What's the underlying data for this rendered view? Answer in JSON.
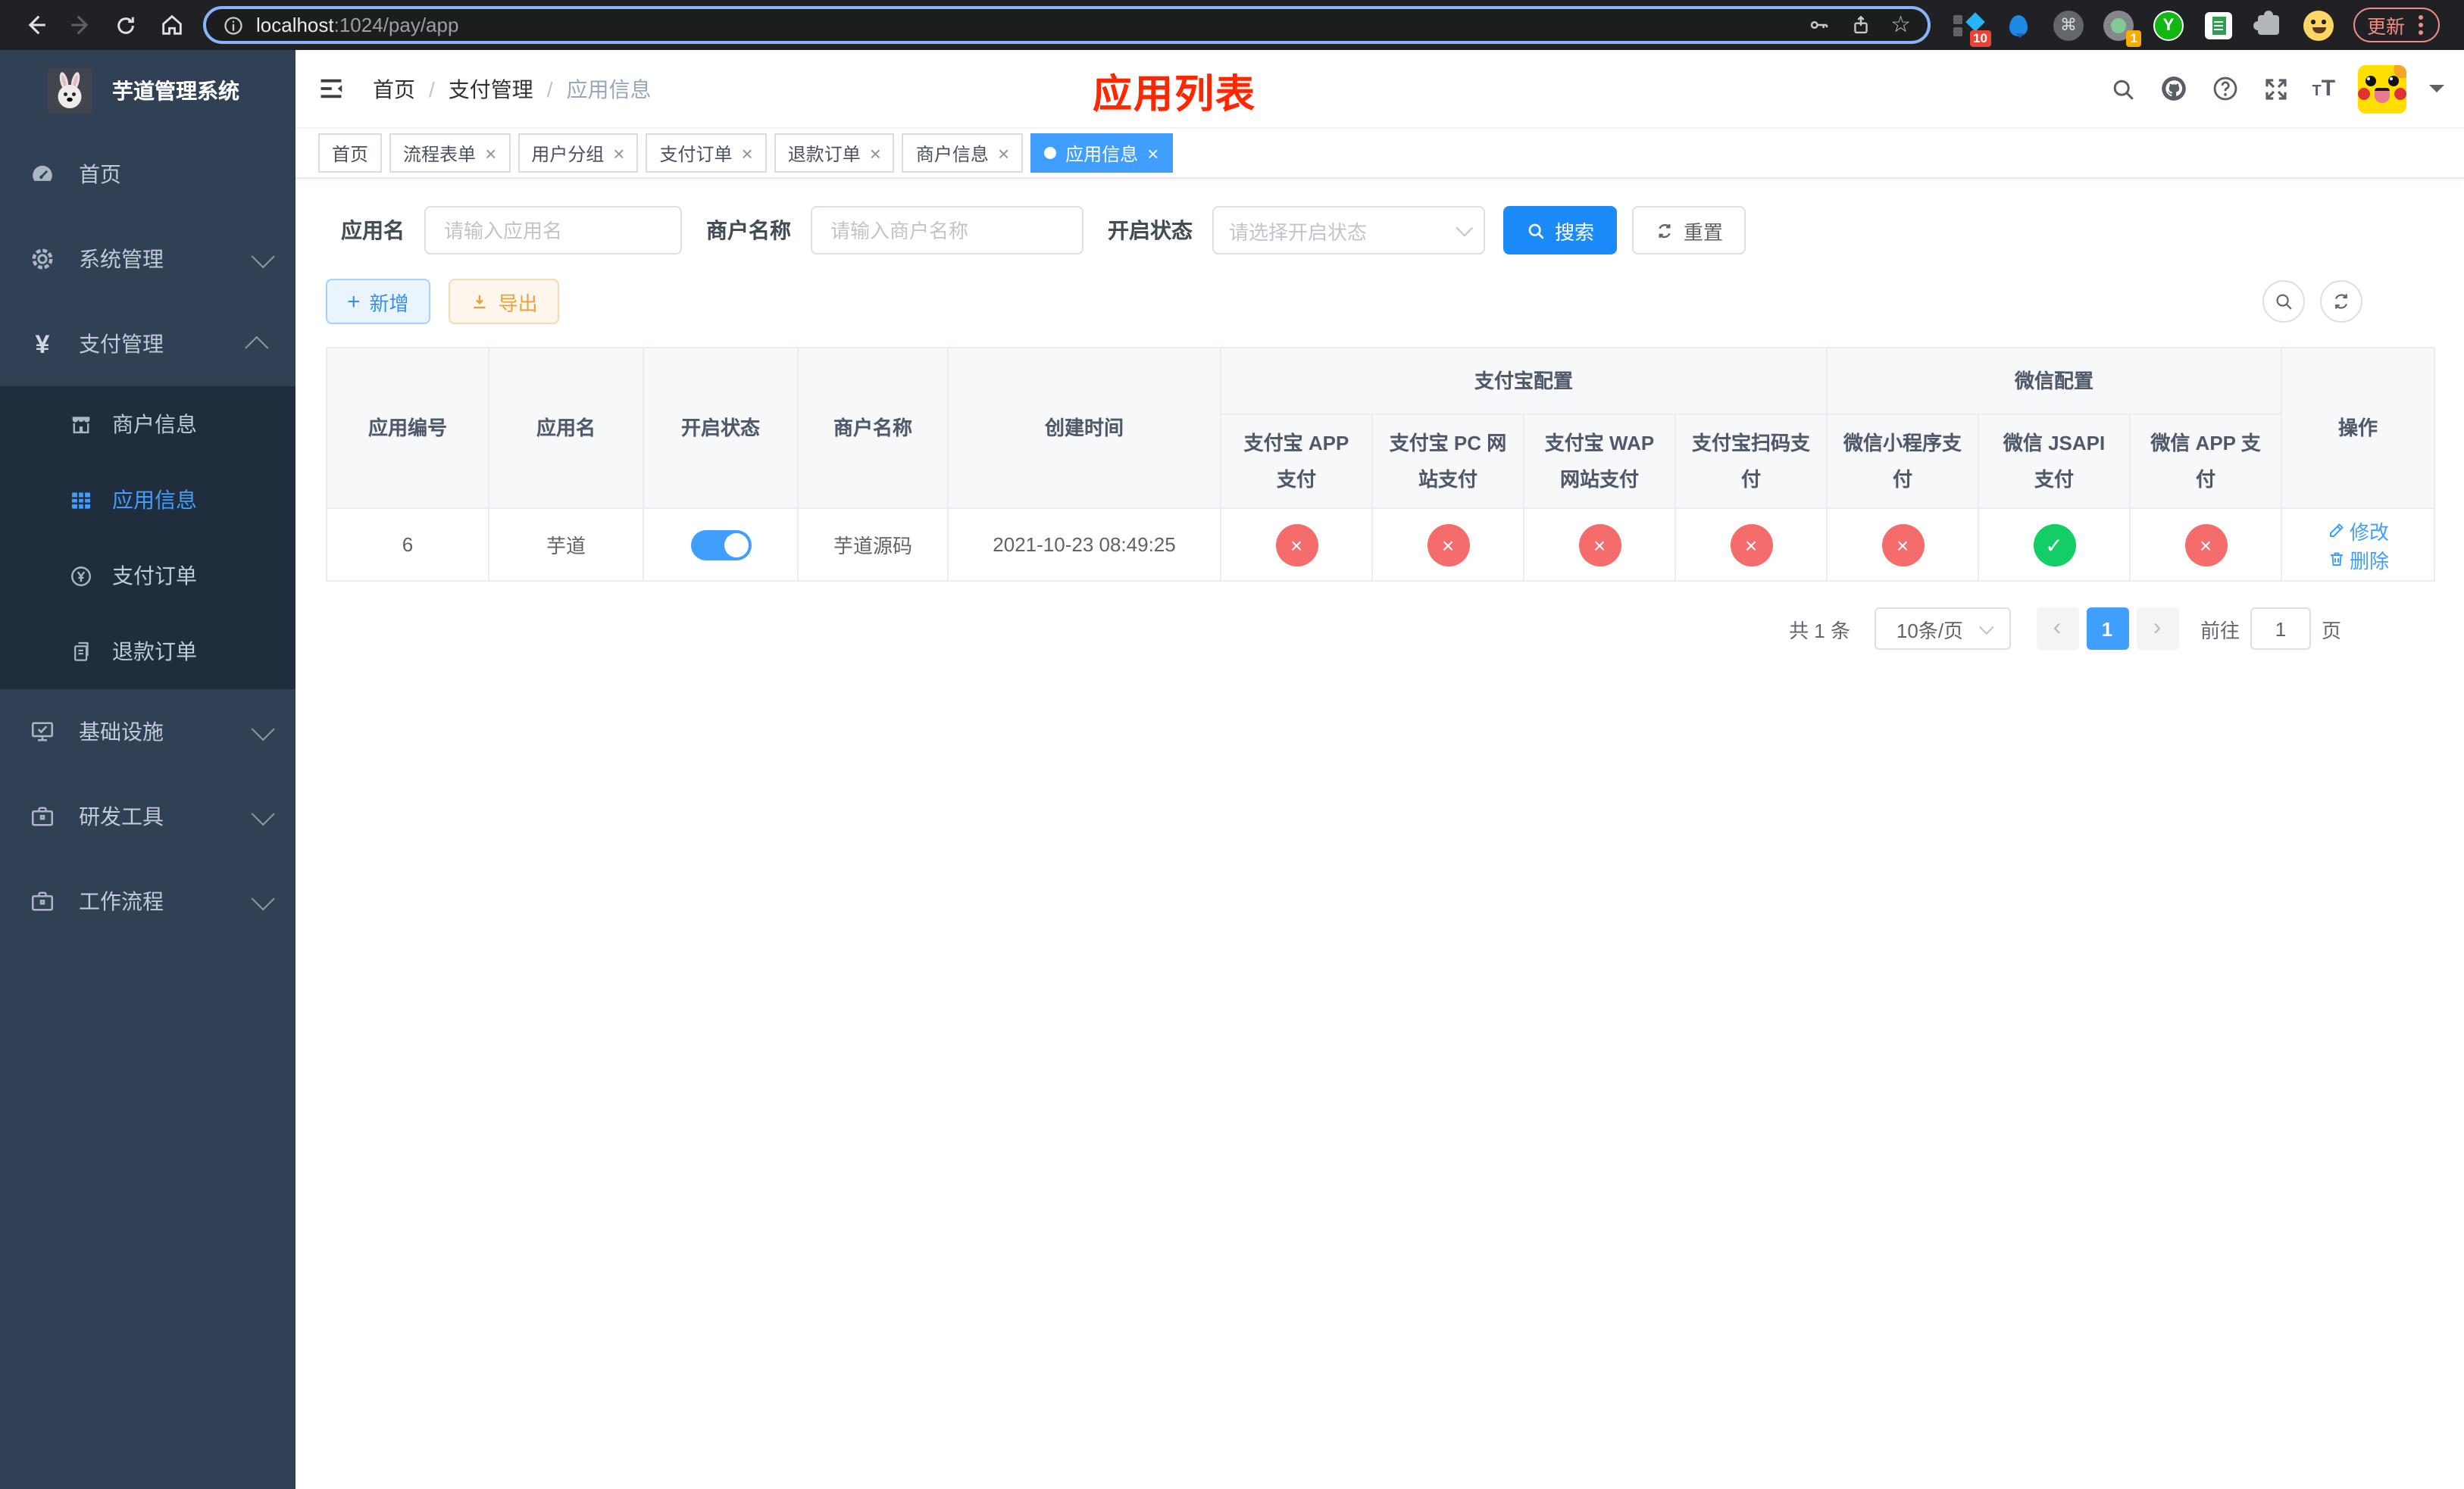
{
  "browser": {
    "url_host": "localhost",
    "url_path": ":1024/pay/app",
    "ext_badge_count": "10",
    "tab_badge_count": "1",
    "ext_y_label": "Y",
    "update_label": "更新"
  },
  "sidebar": {
    "logo_title": "芋道管理系统",
    "menu": [
      {
        "label": "首页"
      },
      {
        "label": "系统管理"
      },
      {
        "label": "支付管理"
      },
      {
        "label": "商户信息"
      },
      {
        "label": "应用信息"
      },
      {
        "label": "支付订单"
      },
      {
        "label": "退款订单"
      },
      {
        "label": "基础设施"
      },
      {
        "label": "研发工具"
      },
      {
        "label": "工作流程"
      }
    ]
  },
  "navbar": {
    "breadcrumb": [
      "首页",
      "支付管理",
      "应用信息"
    ],
    "separator": "/"
  },
  "overlay_title": "应用列表",
  "tabs": [
    {
      "label": "首页"
    },
    {
      "label": "流程表单"
    },
    {
      "label": "用户分组"
    },
    {
      "label": "支付订单"
    },
    {
      "label": "退款订单"
    },
    {
      "label": "商户信息"
    },
    {
      "label": "应用信息"
    }
  ],
  "filters": {
    "app_name_label": "应用名",
    "app_name_placeholder": "请输入应用名",
    "merchant_label": "商户名称",
    "merchant_placeholder": "请输入商户名称",
    "status_label": "开启状态",
    "status_placeholder": "请选择开启状态",
    "search_label": "搜索",
    "reset_label": "重置"
  },
  "toolbar": {
    "add_label": "新增",
    "export_label": "导出"
  },
  "table": {
    "col_app_id": "应用编号",
    "col_app_name": "应用名",
    "col_status": "开启状态",
    "col_merchant": "商户名称",
    "col_created": "创建时间",
    "group_alipay": "支付宝配置",
    "group_wechat": "微信配置",
    "col_alipay_app": "支付宝 APP 支付",
    "col_alipay_pc": "支付宝 PC 网站支付",
    "col_alipay_wap": "支付宝 WAP 网站支付",
    "col_alipay_qr": "支付宝扫码支付",
    "col_wx_lite": "微信小程序支付",
    "col_wx_jsapi": "微信 JSAPI 支付",
    "col_wx_app": "微信 APP 支付",
    "col_actions": "操作",
    "row": {
      "app_id": "6",
      "app_name": "芋道",
      "status_on": true,
      "merchant": "芋道源码",
      "created": "2021-10-23 08:49:25",
      "alipay_app": "disabled",
      "alipay_pc": "disabled",
      "alipay_wap": "disabled",
      "alipay_qr": "disabled",
      "wx_lite": "disabled",
      "wx_jsapi": "enabled",
      "wx_app": "disabled",
      "edit_label": "修改",
      "delete_label": "删除"
    }
  },
  "pagination": {
    "total_label": "共 1 条",
    "page_size_label": "10条/页",
    "current_page": "1",
    "goto_label": "前往",
    "goto_value": "1",
    "page_unit": "页"
  },
  "colors": {
    "primary": "#409eff",
    "success": "#13ce66",
    "danger": "#f56c6c",
    "warning": "#e6a23c",
    "title_red": "#ff2600"
  }
}
